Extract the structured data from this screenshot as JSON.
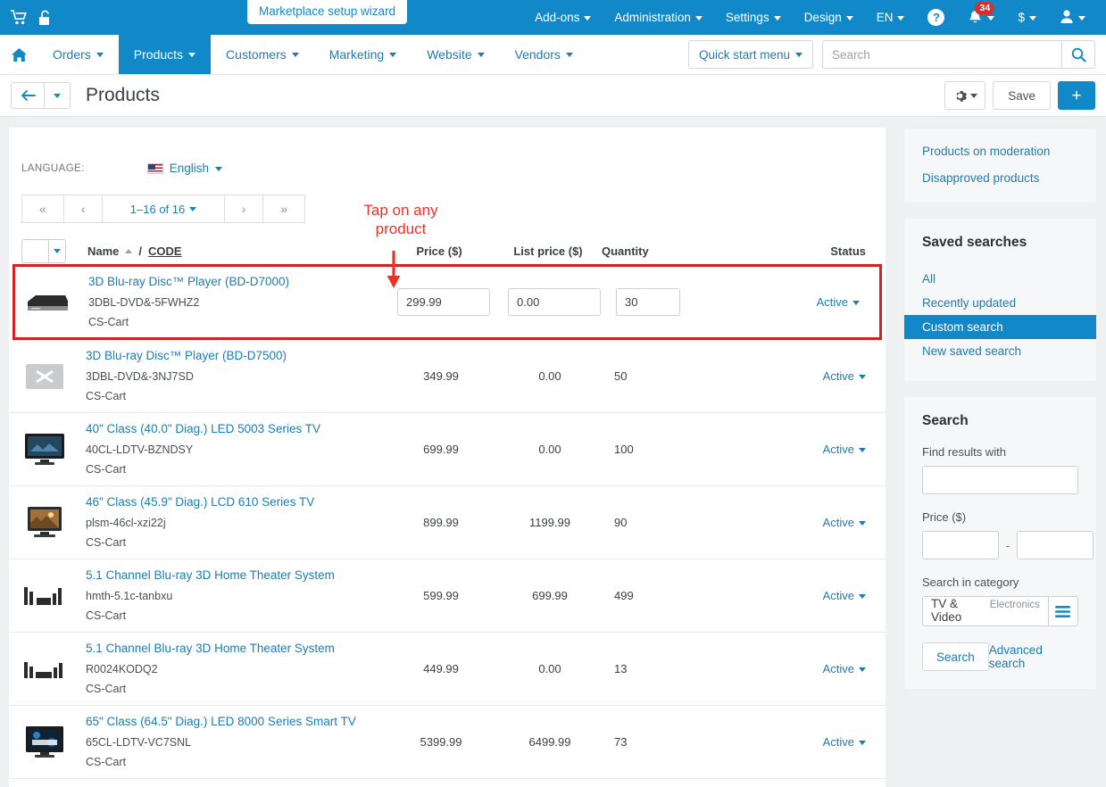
{
  "topbar": {
    "cart_icon": "cart-icon",
    "unlock_icon": "unlock-icon",
    "wizard_pill": "Marketplace setup wizard",
    "menus": [
      {
        "label": "Add-ons"
      },
      {
        "label": "Administration"
      },
      {
        "label": "Settings"
      },
      {
        "label": "Design"
      },
      {
        "label": "EN"
      }
    ],
    "help_glyph": "?",
    "notification_count": "34",
    "currency_glyph": "$"
  },
  "subnav": {
    "home_icon": "home-icon",
    "items": [
      {
        "label": "Orders",
        "active": false
      },
      {
        "label": "Products",
        "active": true
      },
      {
        "label": "Customers",
        "active": false
      },
      {
        "label": "Marketing",
        "active": false
      },
      {
        "label": "Website",
        "active": false
      },
      {
        "label": "Vendors",
        "active": false
      }
    ],
    "quick_start_label": "Quick start menu",
    "search_placeholder": "Search",
    "search_value": ""
  },
  "titlebar": {
    "page_title": "Products",
    "save_label": "Save",
    "plus_label": "+"
  },
  "toolbar": {
    "language_label": "LANGUAGE:",
    "language_value": "English",
    "pager": {
      "first": "«",
      "prev": "‹",
      "count": "1–16 of 16",
      "next": "›",
      "last": "»"
    }
  },
  "annotation": {
    "text_line1": "Tap on any",
    "text_line2": "product",
    "color": "#ee3124"
  },
  "table": {
    "headers": {
      "name": "Name",
      "slash": "/",
      "code": "CODE",
      "price": "Price ($)",
      "list_price": "List price ($)",
      "quantity": "Quantity",
      "status": "Status"
    },
    "rows": [
      {
        "title": "3D Blu-ray Disc™ Player (BD-D7000)",
        "code": "3DBL-DVD&-5FWHZ2",
        "vendor": "CS-Cart",
        "price": "299.99",
        "list_price": "0.00",
        "quantity": "30",
        "status": "Active",
        "editing": true,
        "thumb": "bluray-player-thumb"
      },
      {
        "title": "3D Blu-ray Disc™ Player (BD-D7500)",
        "code": "3DBL-DVD&-3NJ7SD",
        "vendor": "CS-Cart",
        "price": "349.99",
        "list_price": "0.00",
        "quantity": "50",
        "status": "Active",
        "editing": false,
        "thumb": "bluray-player-2-thumb"
      },
      {
        "title": "40\" Class (40.0\" Diag.) LED 5003 Series TV",
        "code": "40CL-LDTV-BZNDSY",
        "vendor": "CS-Cart",
        "price": "699.99",
        "list_price": "0.00",
        "quantity": "100",
        "status": "Active",
        "editing": false,
        "thumb": "led-tv-thumb"
      },
      {
        "title": "46\" Class (45.9\" Diag.) LCD 610 Series TV",
        "code": "plsm-46cl-xzi22j",
        "vendor": "CS-Cart",
        "price": "899.99",
        "list_price": "1199.99",
        "quantity": "90",
        "status": "Active",
        "editing": false,
        "thumb": "lcd-tv-thumb"
      },
      {
        "title": "5.1 Channel Blu-ray 3D Home Theater System",
        "code": "hmth-5.1c-tanbxu",
        "vendor": "CS-Cart",
        "price": "599.99",
        "list_price": "699.99",
        "quantity": "499",
        "status": "Active",
        "editing": false,
        "thumb": "home-theater-thumb"
      },
      {
        "title": "5.1 Channel Blu-ray 3D Home Theater System",
        "code": "R0024KODQ2",
        "vendor": "CS-Cart",
        "price": "449.99",
        "list_price": "0.00",
        "quantity": "13",
        "status": "Active",
        "editing": false,
        "thumb": "home-theater-2-thumb"
      },
      {
        "title": "65\" Class (64.5\" Diag.) LED 8000 Series Smart TV",
        "code": "65CL-LDTV-VC7SNL",
        "vendor": "CS-Cart",
        "price": "5399.99",
        "list_price": "6499.99",
        "quantity": "73",
        "status": "Active",
        "editing": false,
        "thumb": "smart-tv-thumb"
      }
    ]
  },
  "sidebar": {
    "links": [
      {
        "label": "Products on moderation"
      },
      {
        "label": "Disapproved products"
      }
    ],
    "saved_searches": {
      "title": "Saved searches",
      "items": [
        {
          "label": "All",
          "selected": false
        },
        {
          "label": "Recently updated",
          "selected": false
        },
        {
          "label": "Custom search",
          "selected": true
        },
        {
          "label": "New saved search",
          "selected": false
        }
      ]
    },
    "search": {
      "title": "Search",
      "find_label": "Find results with",
      "find_value": "",
      "price_label": "Price ($)",
      "price_from": "",
      "price_to": "",
      "dash": "-",
      "category_label": "Search in category",
      "category_value": "TV & Video",
      "category_parent": "Electronics",
      "search_button": "Search",
      "advanced_link": "Advanced search"
    }
  },
  "colors": {
    "brand_blue": "#1189c9",
    "link_blue": "#1e7cb0",
    "highlight_red": "#d81f26",
    "annotation_red": "#ee3124",
    "badge_red": "#cf3232"
  }
}
